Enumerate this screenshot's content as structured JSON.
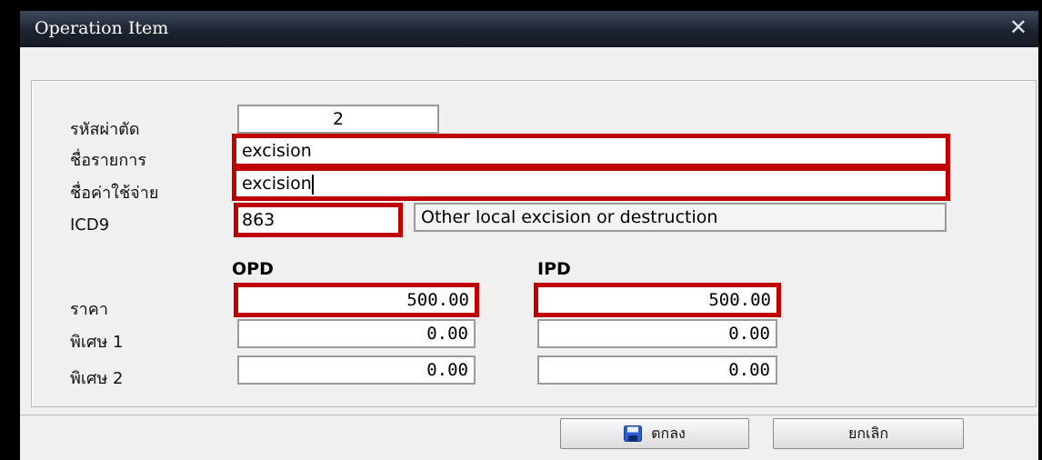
{
  "window": {
    "title": "Operation Item",
    "close_glyph": "✕"
  },
  "form": {
    "code_label": "รหัสผ่าตัด",
    "code_value": "2",
    "item_name_label": "ชื่อรายการ",
    "item_name_value": "excision",
    "expense_name_label": "ชื่อค่าใช้จ่าย",
    "expense_name_value": "excision",
    "icd9_label": "ICD9",
    "icd9_code": "863",
    "icd9_description": "Other local excision or destruction"
  },
  "pricing": {
    "opd_header": "OPD",
    "ipd_header": "IPD",
    "rows": [
      {
        "label": "ราคา",
        "opd": "500.00",
        "ipd": "500.00"
      },
      {
        "label": "พิเศษ 1",
        "opd": "0.00",
        "ipd": "0.00"
      },
      {
        "label": "พิเศษ 2",
        "opd": "0.00",
        "ipd": "0.00"
      }
    ]
  },
  "buttons": {
    "ok_label": "ตกลง",
    "ok_icon": "save-icon",
    "cancel_label": "ยกเลิก"
  },
  "colors": {
    "highlight": "#c00000",
    "titlebar": "#1c2330"
  }
}
